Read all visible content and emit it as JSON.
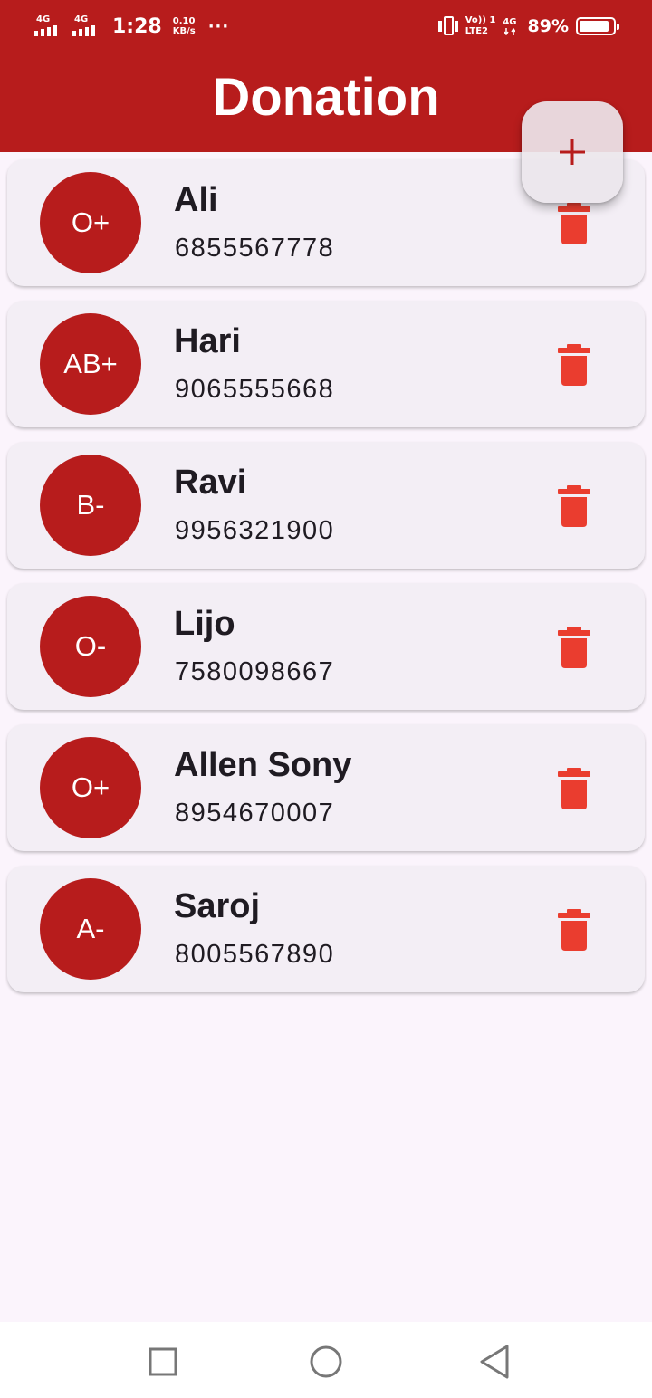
{
  "status_bar": {
    "sim1_label": "4G",
    "sim2_label": "4G",
    "time": "1:28",
    "speed_value": "0.10",
    "speed_unit": "KB/s",
    "more": "···",
    "volte_top": "Vo)) 1",
    "volte_bottom": "LTE2",
    "sig_label": "4G",
    "battery_percent": "89%",
    "battery_level": 0.89
  },
  "app_bar": {
    "title": "Donation"
  },
  "colors": {
    "primary": "#b71c1c",
    "delete": "#ea3d2f",
    "card": "#f3eef5",
    "background": "#fbf4fc"
  },
  "donors": [
    {
      "blood_group": "O+",
      "name": "Ali",
      "phone": "6855567778"
    },
    {
      "blood_group": "AB+",
      "name": "Hari",
      "phone": "9065555668"
    },
    {
      "blood_group": "B-",
      "name": "Ravi",
      "phone": "9956321900"
    },
    {
      "blood_group": "O-",
      "name": "Lijo",
      "phone": "7580098667"
    },
    {
      "blood_group": "O+",
      "name": "Allen Sony",
      "phone": "8954670007"
    },
    {
      "blood_group": "A-",
      "name": "Saroj",
      "phone": "8005567890"
    }
  ],
  "icons": {
    "delete": "trash-icon",
    "fab": "plus-icon",
    "nav_recent": "square-icon",
    "nav_home": "circle-icon",
    "nav_back": "triangle-back-icon"
  }
}
